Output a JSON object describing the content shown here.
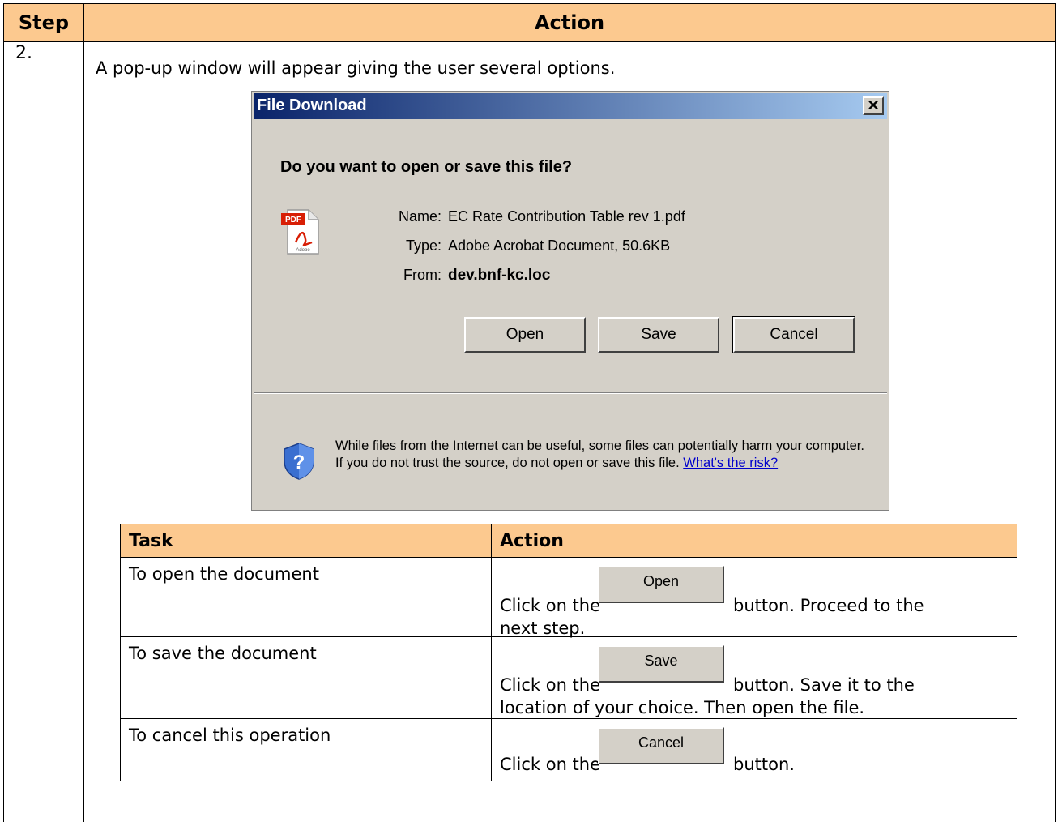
{
  "header": {
    "step": "Step",
    "action": "Action"
  },
  "step_number": "2.",
  "intro": "A pop-up window will appear giving the user several options.",
  "dialog": {
    "title": "File Download",
    "close_glyph": "✕",
    "question": "Do you want to open or save this file?",
    "name_label": "Name:",
    "name_value": "EC Rate Contribution Table rev 1.pdf",
    "type_label": "Type:",
    "type_value": "Adobe Acrobat Document, 50.6KB",
    "from_label": "From:",
    "from_value": "dev.bnf-kc.loc",
    "buttons": {
      "open": "Open",
      "save": "Save",
      "cancel": "Cancel"
    },
    "warning": "While files from the Internet can be useful, some files can potentially harm your computer. If you do not trust the source, do not open or save this file.",
    "risk_link": "What's the risk?",
    "pdf_icon_text": "PDF",
    "adobe_text": "Adobe"
  },
  "task_table": {
    "headers": {
      "task": "Task",
      "action": "Action"
    },
    "rows": [
      {
        "task": "To open the document",
        "prefix": "Click on the",
        "button": "Open",
        "after": "button. Proceed to the",
        "line2": "next step."
      },
      {
        "task": "To save the document",
        "prefix": "Click on the",
        "button": "Save",
        "after": "button.  Save it to the",
        "line2": "location of your choice. Then open the file."
      },
      {
        "task": "To cancel this operation",
        "prefix": "Click on the",
        "button": "Cancel",
        "after": "button.",
        "line2": ""
      }
    ]
  }
}
